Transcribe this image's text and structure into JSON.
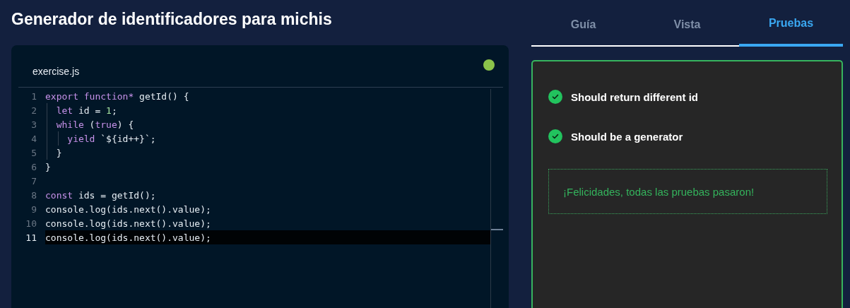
{
  "title": "Generador de identificadores para michis",
  "editor": {
    "filename": "exercise.js",
    "passed": true,
    "lines": [
      {
        "number": "1",
        "current": false,
        "tokens": [
          {
            "kind": "keyword",
            "text": "export function*"
          },
          {
            "kind": "plain",
            "text": " getId() {"
          }
        ]
      },
      {
        "number": "2",
        "current": false,
        "tokens": [
          {
            "kind": "keyword",
            "text": "  let"
          },
          {
            "kind": "plain",
            "text": " id = "
          },
          {
            "kind": "number",
            "text": "1"
          },
          {
            "kind": "plain",
            "text": ";"
          }
        ]
      },
      {
        "number": "3",
        "current": false,
        "tokens": [
          {
            "kind": "keyword",
            "text": "  while"
          },
          {
            "kind": "plain",
            "text": " ("
          },
          {
            "kind": "keyword",
            "text": "true"
          },
          {
            "kind": "plain",
            "text": ") {"
          }
        ]
      },
      {
        "number": "4",
        "current": false,
        "tokens": [
          {
            "kind": "keyword",
            "text": "    yield"
          },
          {
            "kind": "plain",
            "text": " `${id++}`;"
          }
        ]
      },
      {
        "number": "5",
        "current": false,
        "tokens": [
          {
            "kind": "plain",
            "text": "  }"
          }
        ]
      },
      {
        "number": "6",
        "current": false,
        "tokens": [
          {
            "kind": "plain",
            "text": "}"
          }
        ]
      },
      {
        "number": "7",
        "current": false
      },
      {
        "number": "8",
        "current": false,
        "tokens": [
          {
            "kind": "keyword",
            "text": "const"
          },
          {
            "kind": "plain",
            "text": " ids = getId();"
          }
        ]
      },
      {
        "number": "9",
        "current": false,
        "tokens": [
          {
            "kind": "plain",
            "text": "console.log(ids.next().value);"
          }
        ]
      },
      {
        "number": "10",
        "current": false,
        "tokens": [
          {
            "kind": "plain",
            "text": "console.log(ids.next().value);"
          }
        ]
      },
      {
        "number": "11",
        "current": true,
        "tokens": [
          {
            "kind": "plain",
            "text": "console.log(ids.next().value);"
          }
        ]
      }
    ]
  },
  "tabs": [
    {
      "label": "Guía",
      "selected": false
    },
    {
      "label": "Vista",
      "selected": false
    },
    {
      "label": "Pruebas",
      "selected": true
    }
  ],
  "tests": [
    {
      "name": "Should return different id",
      "passed": true
    },
    {
      "name": "Should be a generator",
      "passed": true
    }
  ],
  "result_message": "¡Felicidades, todas las pruebas pasaron!"
}
